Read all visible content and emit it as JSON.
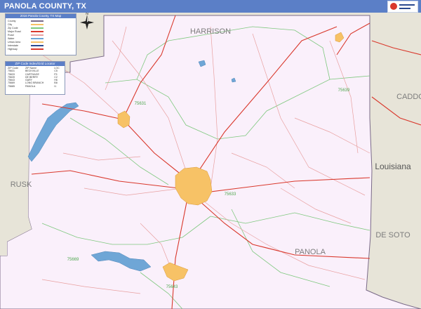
{
  "title": "PANOLA COUNTY, TX",
  "colors": {
    "title_bar": "#5b7fc7",
    "county_fill": "#faf0fb",
    "surrounding_fill": "#e7e4d8",
    "water": "#6fa6d6",
    "urban": "#f7c266",
    "highway": "#d9382c",
    "road": "#e8a0a0",
    "zip_boundary": "#7ec87e"
  },
  "surrounding_labels": [
    "HARRISON",
    "CADDO",
    "Louisiana",
    "RUSK",
    "DE SOTO"
  ],
  "county_label": "PANOLA",
  "zip_labels": [
    "75631",
    "75639",
    "75633",
    "75669",
    "75643"
  ],
  "legend": {
    "title": "2016 Panola County, TX Map",
    "rows": [
      "County",
      "City",
      "Zip Code",
      "Major Road",
      "Road",
      "Water",
      "Urban Area",
      "Interstate",
      "Highway"
    ]
  },
  "zip_table": {
    "title": "ZIP Code Index/Grid Locator",
    "headers": [
      "ZIP Code",
      "ZIP Name",
      "LOC"
    ],
    "rows": [
      [
        "75631",
        "BECKVILLE",
        "C5"
      ],
      [
        "75633",
        "CARTHAGE",
        "F5"
      ],
      [
        "75639",
        "DE BERRY",
        "C2"
      ],
      [
        "75643",
        "GARY",
        "H6"
      ],
      [
        "75669",
        "LONG BRANCH",
        "B8"
      ],
      [
        "75685",
        "PANOLA",
        "I1"
      ]
    ]
  },
  "compass": "N"
}
